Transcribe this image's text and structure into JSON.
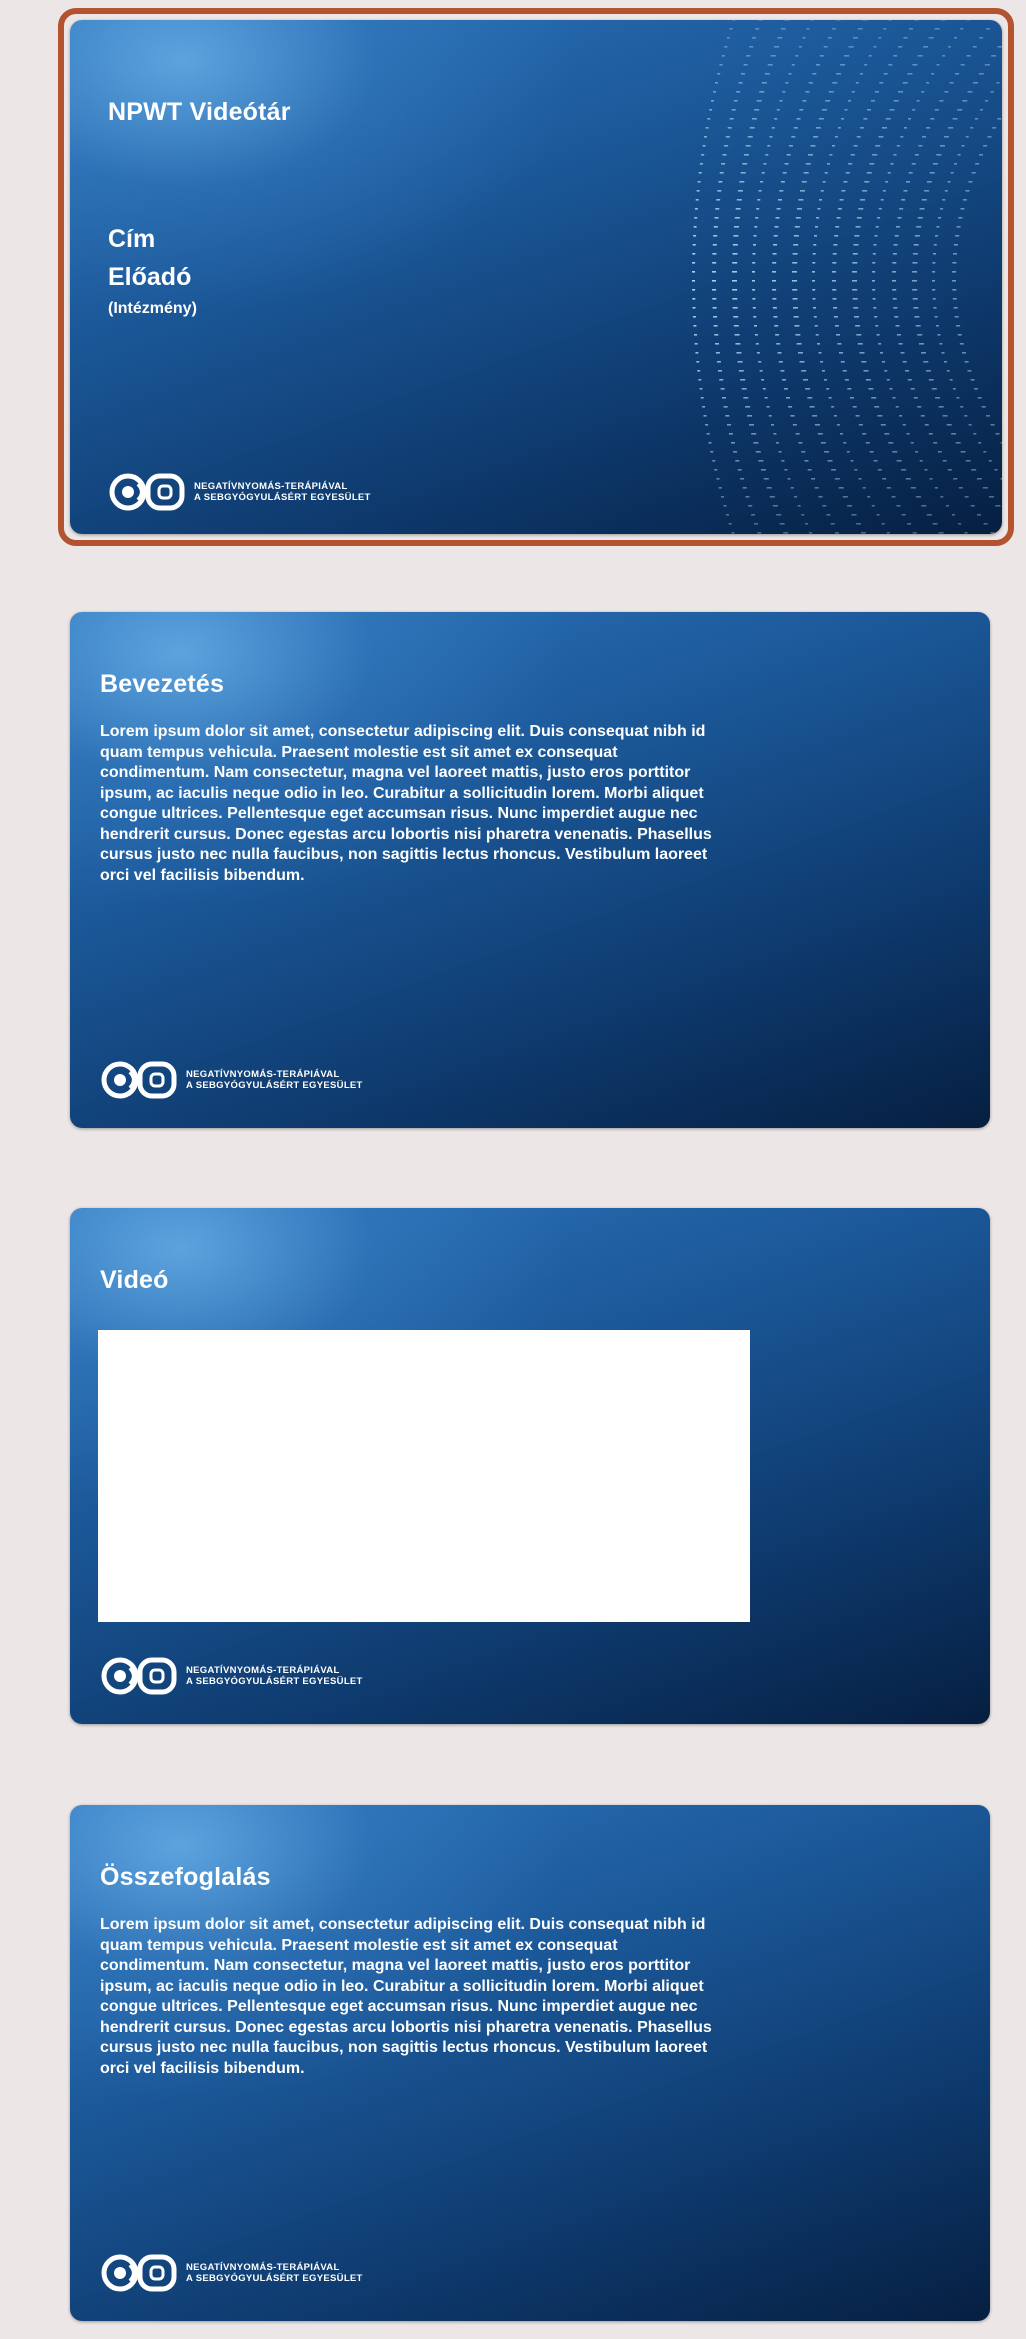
{
  "slides": [
    {
      "title": "NPWT Videótár",
      "cim": "Cím",
      "eloado": "Előadó",
      "intezmeny": "(Intézmény)",
      "logo": {
        "line1": "NEGATÍVNYOMÁS-TERÁPIÁVAL",
        "line2": "A SEBGYÓGYULÁSÉRT EGYESÜLET"
      }
    },
    {
      "title": "Bevezetés",
      "body": "Lorem ipsum dolor sit amet, consectetur adipiscing elit. Duis consequat nibh id quam tempus vehicula. Praesent molestie est sit amet ex consequat condimentum. Nam consectetur, magna vel laoreet mattis, justo eros porttitor ipsum, ac iaculis neque odio in leo. Curabitur a sollicitudin lorem. Morbi aliquet congue ultrices. Pellentesque eget accumsan risus. Nunc imperdiet augue nec hendrerit cursus. Donec egestas arcu lobortis nisi pharetra venenatis. Phasellus cursus justo nec nulla faucibus, non sagittis lectus rhoncus. Vestibulum laoreet orci vel facilisis bibendum.",
      "logo": {
        "line1": "NEGATÍVNYOMÁS-TERÁPIÁVAL",
        "line2": "A SEBGYÓGYULÁSÉRT EGYESÜLET"
      }
    },
    {
      "title": "Videó",
      "logo": {
        "line1": "NEGATÍVNYOMÁS-TERÁPIÁVAL",
        "line2": "A SEBGYÓGYULÁSÉRT EGYESÜLET"
      }
    },
    {
      "title": "Összefoglalás",
      "body": "Lorem ipsum dolor sit amet, consectetur adipiscing elit. Duis consequat nibh id quam tempus vehicula. Praesent molestie est sit amet ex consequat condimentum. Nam consectetur, magna vel laoreet mattis, justo eros porttitor ipsum, ac iaculis neque odio in leo. Curabitur a sollicitudin lorem. Morbi aliquet congue ultrices. Pellentesque eget accumsan risus. Nunc imperdiet augue nec hendrerit cursus. Donec egestas arcu lobortis nisi pharetra venenatis. Phasellus cursus justo nec nulla faucibus, non sagittis lectus rhoncus. Vestibulum laoreet orci vel facilisis bibendum.",
      "logo": {
        "line1": "NEGATÍVNYOMÁS-TERÁPIÁVAL",
        "line2": "A SEBGYÓGYULÁSÉRT EGYESÜLET"
      }
    }
  ],
  "colors": {
    "background": "#ece7e6",
    "selection_border": "#b3532f",
    "slide_dark": "#061f41",
    "slide_light": "#2f78bf"
  }
}
